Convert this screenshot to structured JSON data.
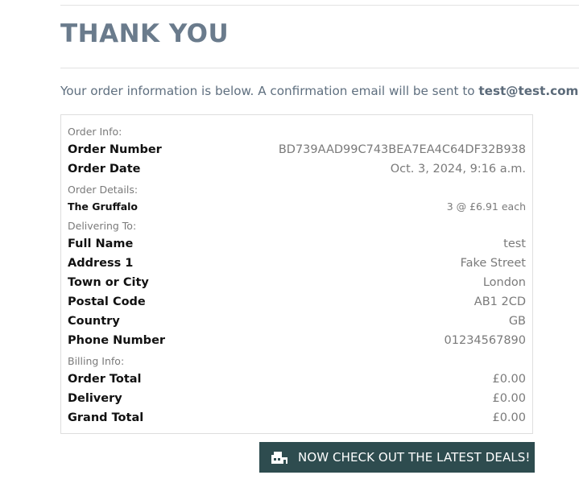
{
  "header": {
    "title": "THANK YOU"
  },
  "intro": {
    "text": "Your order information is below. A confirmation email will be sent to ",
    "email": "test@test.com"
  },
  "order_info": {
    "section_label": "Order Info:",
    "rows": [
      {
        "label": "Order Number",
        "value": "BD739AAD99C743BEA7EA4C64DF32B938"
      },
      {
        "label": "Order Date",
        "value": "Oct. 3, 2024, 9:16 a.m."
      }
    ]
  },
  "order_details": {
    "section_label": "Order Details:",
    "items": [
      {
        "name": "The Gruffalo",
        "qty_price": "3 @ £6.91 each"
      }
    ]
  },
  "delivering_to": {
    "section_label": "Delivering To:",
    "rows": [
      {
        "label": "Full Name",
        "value": "test"
      },
      {
        "label": "Address 1",
        "value": "Fake Street"
      },
      {
        "label": "Town or City",
        "value": "London"
      },
      {
        "label": "Postal Code",
        "value": "AB1 2CD"
      },
      {
        "label": "Country",
        "value": "GB"
      },
      {
        "label": "Phone Number",
        "value": "01234567890"
      }
    ]
  },
  "billing_info": {
    "section_label": "Billing Info:",
    "rows": [
      {
        "label": "Order Total",
        "value": "£0.00"
      },
      {
        "label": "Delivery",
        "value": "£0.00"
      },
      {
        "label": "Grand Total",
        "value": "£0.00"
      }
    ]
  },
  "cta": {
    "label": "NOW CHECK OUT THE LATEST DEALS!",
    "icon": "shop-icon"
  },
  "colors": {
    "title": "#6a7b8c",
    "button_bg": "#2e4c4f"
  }
}
